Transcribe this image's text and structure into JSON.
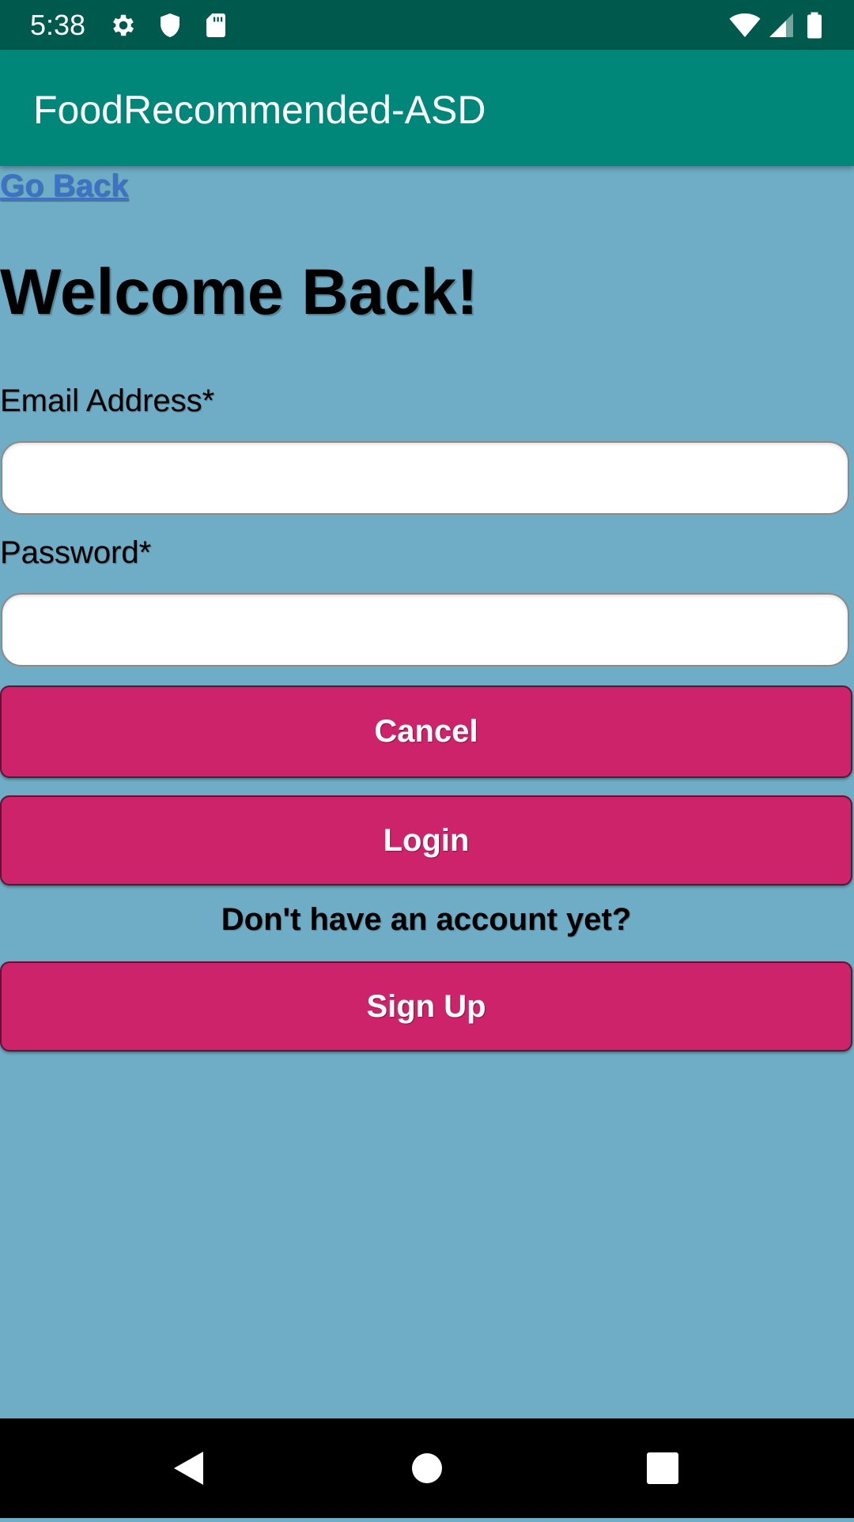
{
  "status_bar": {
    "time": "5:38",
    "icons_left": [
      "gear-icon",
      "shield-icon",
      "sd-card-icon"
    ],
    "icons_right": [
      "wifi-icon",
      "signal-icon",
      "battery-icon"
    ]
  },
  "app_bar": {
    "title": "FoodRecommended-ASD"
  },
  "colors": {
    "status_bar": "#00594d",
    "app_bar": "#00877a",
    "background": "#6eadc5",
    "button": "#cd236a",
    "link": "#3a73c8"
  },
  "page": {
    "go_back": "Go Back",
    "title": "Welcome Back!",
    "email_label": "Email Address*",
    "email_value": "",
    "password_label": "Password*",
    "password_value": "",
    "cancel_button": "Cancel",
    "login_button": "Login",
    "account_prompt": "Don't have an account yet?",
    "signup_button": "Sign Up"
  },
  "nav_bar": {
    "buttons": [
      "back-icon",
      "home-icon",
      "recents-icon"
    ]
  }
}
